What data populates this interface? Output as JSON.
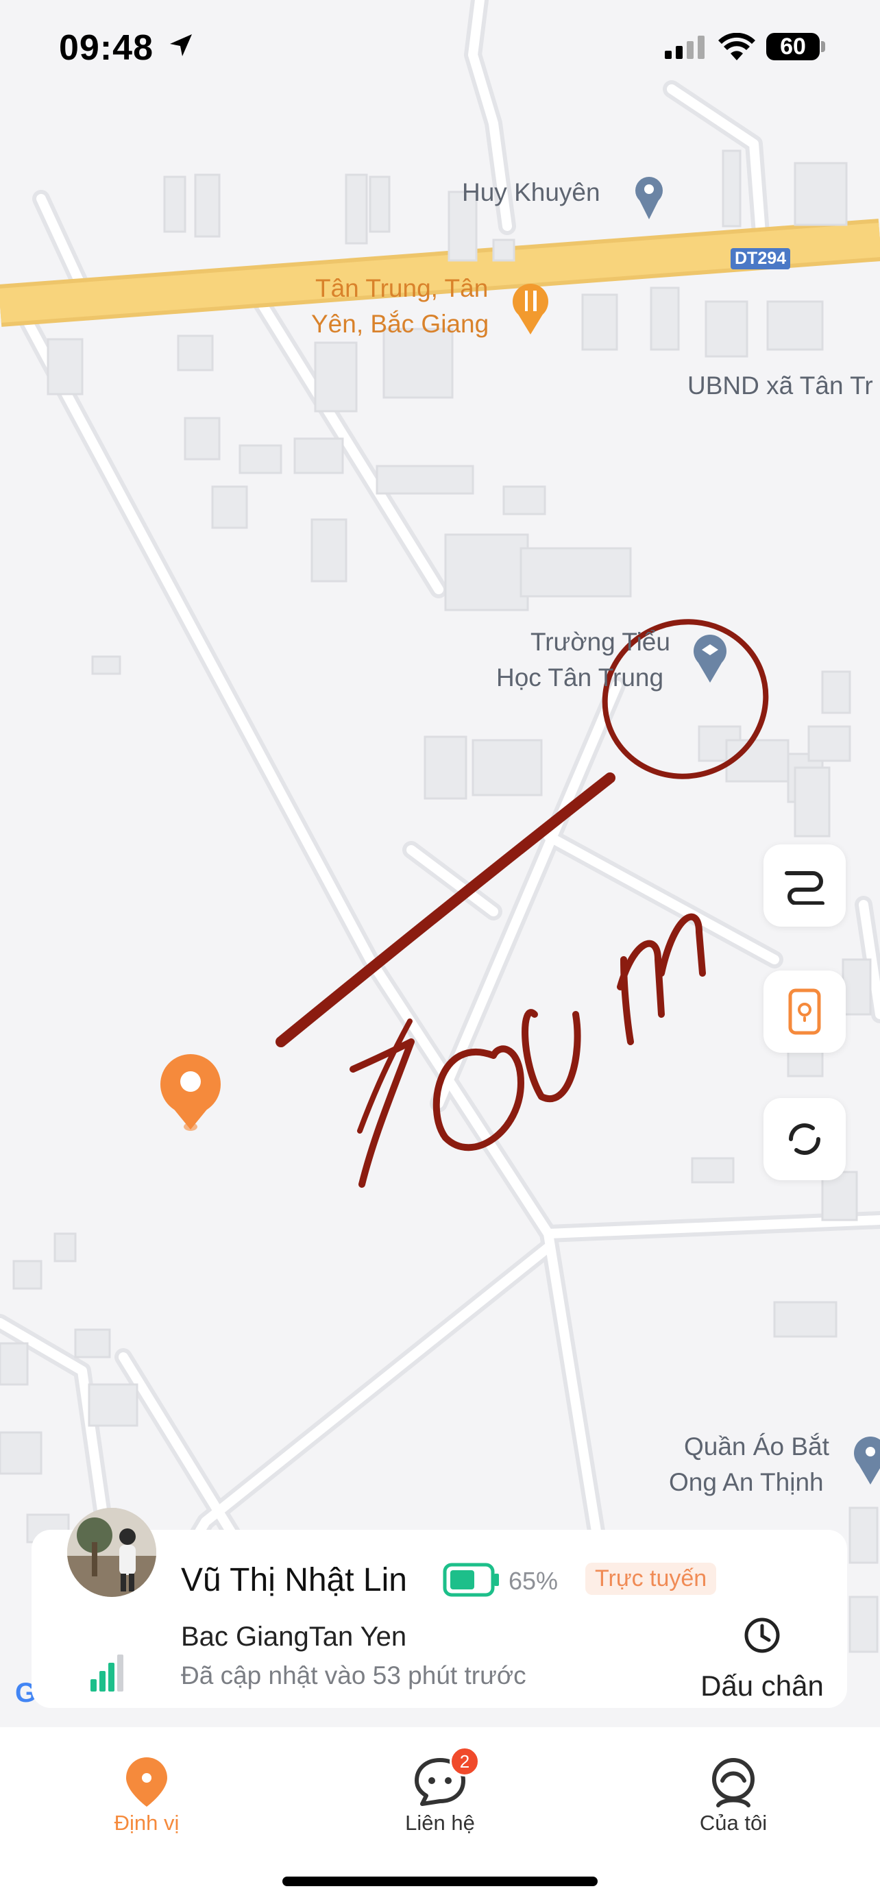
{
  "status_bar": {
    "time": "09:48",
    "battery": "60"
  },
  "map": {
    "labels": {
      "huy_khuyen": "Huy Khuyên",
      "tan_trung_1": "Tân Trung, Tân",
      "tan_trung_2": "Yên, Bắc Giang",
      "ubnd": "UBND xã Tân Tr",
      "school_1": "Trường Tiểu",
      "school_2": "Học Tân Trung",
      "shop_1": "Quần Áo Bắt",
      "shop_2": "Ong An Thịnh",
      "road_shield": "DT294"
    },
    "annotation": "700m"
  },
  "side_buttons": [
    {
      "icon": "route-icon"
    },
    {
      "icon": "phone-locate-icon"
    },
    {
      "icon": "refresh-icon"
    }
  ],
  "person_card": {
    "name": "Vũ Thị Nhật Lin",
    "battery_percent": "65%",
    "battery_level": 0.65,
    "status": "Trực tuyến",
    "address": "Bac GiangTan Yen",
    "updated": "Đã cập nhật vào 53 phút trước",
    "history_label": "Dấu chân"
  },
  "tabbar": {
    "tabs": [
      {
        "label": "Định vị",
        "active": true
      },
      {
        "label": "Liên hệ",
        "badge": "2"
      },
      {
        "label": "Của tôi"
      }
    ]
  },
  "colors": {
    "accent": "#f58a3c",
    "road_main": "#f8d47c",
    "marker": "#f58a3c",
    "annotation": "#8b1c10"
  }
}
